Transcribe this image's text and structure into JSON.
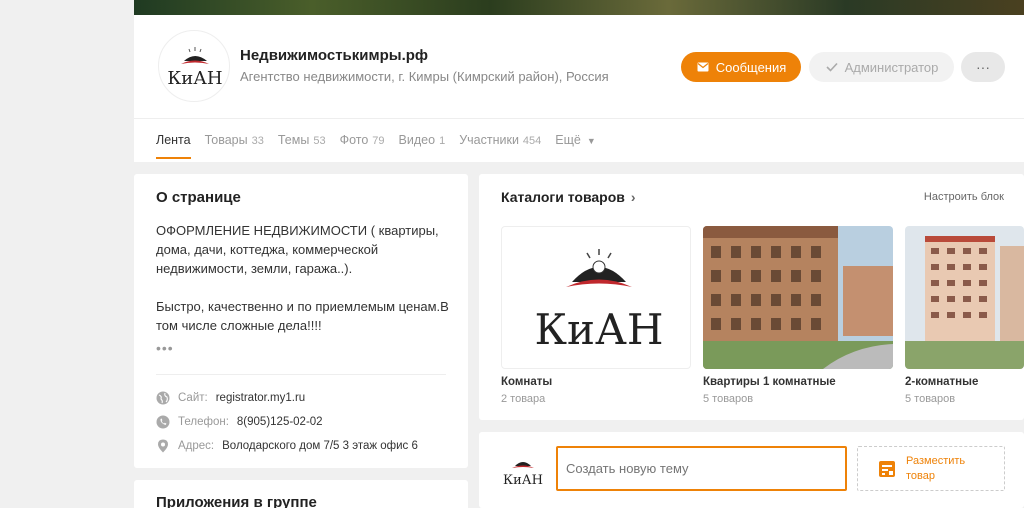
{
  "header": {
    "title": "Недвижимостькимры.рф",
    "subtitle": "Агентство недвижимости, г. Кимры (Кимрский район), Россия",
    "logo_text": "КиАН",
    "messages_button": "Сообщения",
    "admin_button": "Администратор",
    "more_button": "···",
    "accent_color": "#ee8208"
  },
  "nav": {
    "feed": "Лента",
    "products": "Товары",
    "products_count": "33",
    "topics": "Темы",
    "topics_count": "53",
    "photos": "Фото",
    "photos_count": "79",
    "videos": "Видео",
    "videos_count": "1",
    "members": "Участники",
    "members_count": "454",
    "more": "Ещё"
  },
  "about": {
    "title": "О странице",
    "description": "ОФОРМЛЕНИЕ НЕДВИЖИМОСТИ ( квартиры, дома, дачи, коттеджа, коммерческой недвижимости, земли, гаража..).\n\nБыстро, качественно и по приемлемым ценам.В том числе сложные дела!!!!",
    "more": "•••",
    "site_label": "Сайт:",
    "site_value": "registrator.my1.ru",
    "phone_label": "Телефон:",
    "phone_value": "8(905)125-02-02",
    "address_label": "Адрес:",
    "address_value": "Володарского дом 7/5 3 этаж офис 6"
  },
  "apps": {
    "title": "Приложения в группе"
  },
  "catalog": {
    "title": "Каталоги товаров",
    "setup": "Настроить блок",
    "items": [
      {
        "name": "Комнаты",
        "count": "2 товара",
        "logo_text": "КиАН"
      },
      {
        "name": "Квартиры 1 комнатные",
        "count": "5 товаров"
      },
      {
        "name": "2-комнатные",
        "count": "5 товаров"
      }
    ]
  },
  "composer": {
    "placeholder": "Создать новую тему",
    "place_product": "Разместить товар",
    "logo_text": "КиАН"
  }
}
